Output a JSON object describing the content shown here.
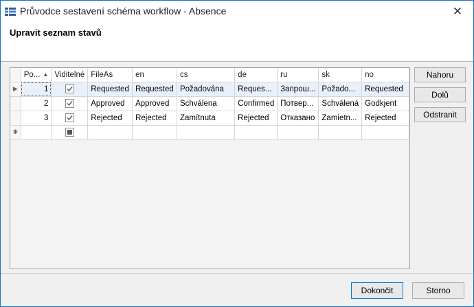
{
  "window": {
    "title": "Průvodce sestavení schéma workflow - Absence",
    "close_symbol": "✕"
  },
  "header": {
    "title": "Upravit seznam stavů"
  },
  "grid": {
    "columns": [
      "Po...",
      "Viditelné",
      "FileAs",
      "en",
      "cs",
      "de",
      "ru",
      "sk",
      "no"
    ],
    "rows": [
      {
        "order": "1",
        "visible": true,
        "fileas": "Requested",
        "en": "Requested",
        "cs": "Požadována",
        "de": "Reques...",
        "ru": "Запрош...",
        "sk": "Požado...",
        "no": "Requested"
      },
      {
        "order": "2",
        "visible": true,
        "fileas": "Approved",
        "en": "Approved",
        "cs": "Schválena",
        "de": "Confirmed",
        "ru": "Потвер...",
        "sk": "Schválená",
        "no": "Godkjent"
      },
      {
        "order": "3",
        "visible": true,
        "fileas": "Rejected",
        "en": "Rejected",
        "cs": "Zamítnuta",
        "de": "Rejected",
        "ru": "Отказано",
        "sk": "Zamietn...",
        "no": "Rejected"
      }
    ],
    "selected_row_indicator": "▶",
    "new_row_indicator": "✱"
  },
  "buttons": {
    "up": "Nahoru",
    "down": "Dolů",
    "remove": "Odstranit",
    "finish": "Dokončit",
    "cancel": "Storno"
  }
}
